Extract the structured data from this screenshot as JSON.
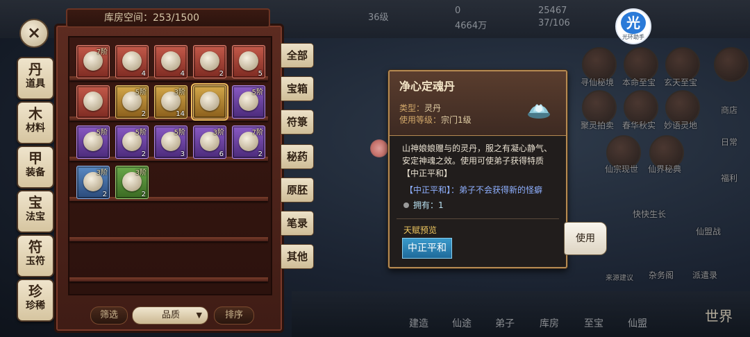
{
  "storage": {
    "label": "库房空间",
    "used": 253,
    "capacity": 1500,
    "text": "库房空间：253/1500"
  },
  "top_stats": {
    "stat1": "0",
    "stat2": "4664万",
    "stat3": "25467",
    "stat4": "37/106",
    "stat5": "36级"
  },
  "helper_badge": {
    "glyph": "光",
    "caption": "光环助手"
  },
  "categories": [
    {
      "icon": "丹",
      "label": "道具"
    },
    {
      "icon": "木",
      "label": "材料"
    },
    {
      "icon": "甲",
      "label": "装备"
    },
    {
      "icon": "宝",
      "label": "法宝"
    },
    {
      "icon": "符",
      "label": "玉符"
    },
    {
      "icon": "珍",
      "label": "珍稀"
    }
  ],
  "tabs": [
    "全部",
    "宝箱",
    "符箓",
    "秘药",
    "原胚",
    "笔录",
    "其他"
  ],
  "items": [
    {
      "rank": "7阶",
      "qty": "",
      "rarity": "red",
      "icon": "teapot"
    },
    {
      "rank": "",
      "qty": "4",
      "rarity": "red",
      "icon": "peach"
    },
    {
      "rank": "",
      "qty": "4",
      "rarity": "red",
      "icon": "peach"
    },
    {
      "rank": "",
      "qty": "2",
      "rarity": "red",
      "icon": "peach"
    },
    {
      "rank": "",
      "qty": "5",
      "rarity": "red",
      "icon": "peach"
    },
    {
      "rank": "",
      "qty": "",
      "rarity": "red",
      "icon": "peach"
    },
    {
      "rank": "5阶",
      "qty": "2",
      "rarity": "gold",
      "icon": "herb"
    },
    {
      "rank": "3阶",
      "qty": "14",
      "rarity": "gold",
      "icon": "jar"
    },
    {
      "rank": "",
      "qty": "",
      "rarity": "gold",
      "icon": "lotus-pill",
      "selected": true
    },
    {
      "rank": "5阶",
      "qty": "",
      "rarity": "purple",
      "icon": "teapot"
    },
    {
      "rank": "5阶",
      "qty": "",
      "rarity": "purple",
      "icon": "teapot"
    },
    {
      "rank": "5阶",
      "qty": "2",
      "rarity": "purple",
      "icon": "gourd"
    },
    {
      "rank": "5阶",
      "qty": "3",
      "rarity": "purple",
      "icon": "herb"
    },
    {
      "rank": "3阶",
      "qty": "6",
      "rarity": "purple",
      "icon": "jar"
    },
    {
      "rank": "7阶",
      "qty": "2",
      "rarity": "purple",
      "icon": "teapot"
    },
    {
      "rank": "3阶",
      "qty": "2",
      "rarity": "blue",
      "icon": "jar"
    },
    {
      "rank": "3阶",
      "qty": "2",
      "rarity": "green",
      "icon": "jar"
    }
  ],
  "controls": {
    "filter_label": "筛选",
    "sort_value": "品质",
    "order_label": "排序"
  },
  "detail": {
    "name": "净心定魂丹",
    "type_key": "类型：",
    "type_val": "灵丹",
    "level_key": "使用等级：",
    "level_val": "宗门1级",
    "description": "山神娘娘赠与的灵丹，服之有凝心静气、安定神魂之效。使用可使弟子获得特质【中正平和】",
    "trait_line": "【中正平和】：弟子不会获得新的怪癖",
    "owned_label": "拥有：",
    "owned_count": "1",
    "preview_label": "天赋预览",
    "talent_button": "中正平和"
  },
  "use_button": "使用",
  "bottom_nav": [
    "建造",
    "仙途",
    "弟子",
    "库房",
    "至宝",
    "仙盟",
    "世界"
  ],
  "bg_right_labels": [
    "寻仙秘境",
    "本命至宝",
    "玄天至宝",
    "商店",
    "聚灵拍卖",
    "春华秋实",
    "妙语灵地",
    "日常",
    "仙宗现世",
    "仙界秘典",
    "福利",
    "快快生长",
    "仙盟战",
    "来源建议",
    "杂务阁",
    "派遣录"
  ],
  "colors": {
    "cabinet": "#5c2b20",
    "popup_border": "#b58a52",
    "talent_btn": "#2a86bb",
    "trait_text": "#8fb0ff"
  }
}
